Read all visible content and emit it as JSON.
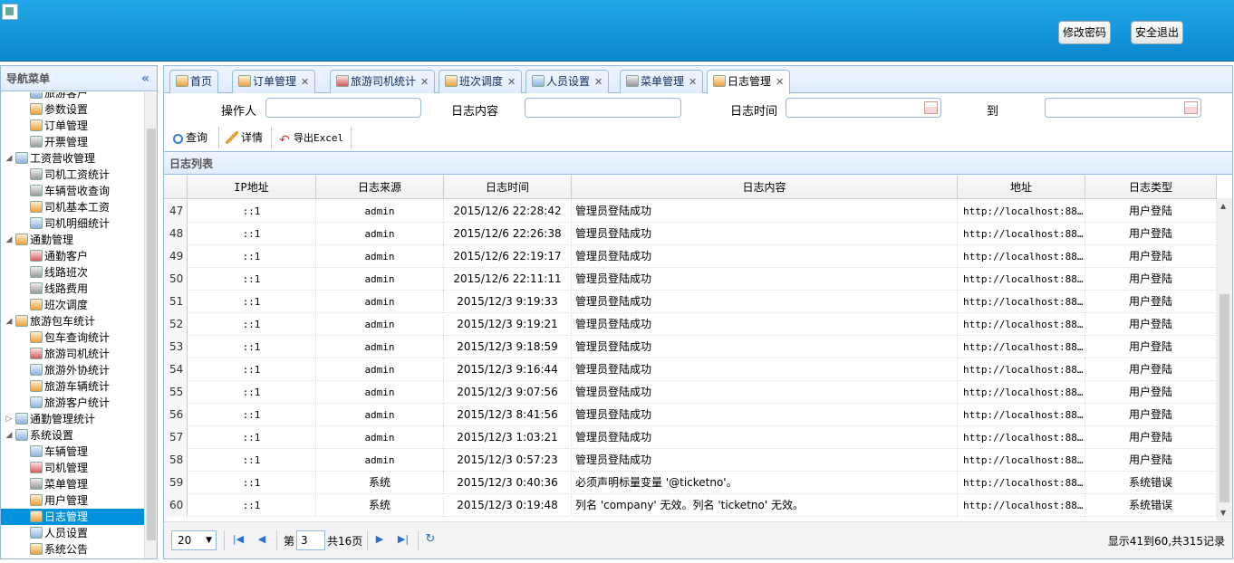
{
  "header": {
    "change_password": "修改密码",
    "logout": "安全退出"
  },
  "nav": {
    "title": "导航菜单",
    "collapse_icon": "«",
    "items": [
      {
        "label": "旅游客户",
        "level": 1,
        "icon": "b"
      },
      {
        "label": "参数设置",
        "level": 1,
        "icon": "o"
      },
      {
        "label": "订单管理",
        "level": 1,
        "icon": "o"
      },
      {
        "label": "开票管理",
        "level": 1,
        "icon": "g"
      },
      {
        "label": "工资营收管理",
        "level": 0,
        "icon": "b",
        "arrow": "◢"
      },
      {
        "label": "司机工资统计",
        "level": 1,
        "icon": "g"
      },
      {
        "label": "车辆营收查询",
        "level": 1,
        "icon": "g"
      },
      {
        "label": "司机基本工资",
        "level": 1,
        "icon": "o"
      },
      {
        "label": "司机明细统计",
        "level": 1,
        "icon": "b"
      },
      {
        "label": "通勤管理",
        "level": 0,
        "icon": "o",
        "arrow": "◢"
      },
      {
        "label": "通勤客户",
        "level": 1,
        "icon": "r"
      },
      {
        "label": "线路班次",
        "level": 1,
        "icon": "g"
      },
      {
        "label": "线路费用",
        "level": 1,
        "icon": "g"
      },
      {
        "label": "班次调度",
        "level": 1,
        "icon": "o"
      },
      {
        "label": "旅游包车统计",
        "level": 0,
        "icon": "o",
        "arrow": "◢"
      },
      {
        "label": "包车查询统计",
        "level": 1,
        "icon": "o"
      },
      {
        "label": "旅游司机统计",
        "level": 1,
        "icon": "r"
      },
      {
        "label": "旅游外协统计",
        "level": 1,
        "icon": "b"
      },
      {
        "label": "旅游车辆统计",
        "level": 1,
        "icon": "o"
      },
      {
        "label": "旅游客户统计",
        "level": 1,
        "icon": "b"
      },
      {
        "label": "通勤管理统计",
        "level": 0,
        "icon": "b",
        "arrow": "▷"
      },
      {
        "label": "系统设置",
        "level": 0,
        "icon": "b",
        "arrow": "◢"
      },
      {
        "label": "车辆管理",
        "level": 1,
        "icon": "b"
      },
      {
        "label": "司机管理",
        "level": 1,
        "icon": "r"
      },
      {
        "label": "菜单管理",
        "level": 1,
        "icon": "g"
      },
      {
        "label": "用户管理",
        "level": 1,
        "icon": "o"
      },
      {
        "label": "日志管理",
        "level": 1,
        "icon": "o",
        "selected": true
      },
      {
        "label": "人员设置",
        "level": 1,
        "icon": "b"
      },
      {
        "label": "系统公告",
        "level": 1,
        "icon": "o"
      }
    ]
  },
  "tabs": [
    {
      "label": "首页",
      "closable": false,
      "icon": "o"
    },
    {
      "label": "订单管理",
      "closable": true,
      "icon": "o"
    },
    {
      "label": "旅游司机统计",
      "closable": true,
      "icon": "r"
    },
    {
      "label": "班次调度",
      "closable": true,
      "icon": "o"
    },
    {
      "label": "人员设置",
      "closable": true,
      "icon": "b"
    },
    {
      "label": "菜单管理",
      "closable": true,
      "icon": "g"
    },
    {
      "label": "日志管理",
      "closable": true,
      "icon": "o",
      "active": true
    }
  ],
  "filter": {
    "operator_label": "操作人",
    "content_label": "日志内容",
    "time_label": "日志时间",
    "to_label": "到"
  },
  "toolbar": {
    "query": "查询",
    "detail": "详情",
    "export": "导出Excel"
  },
  "grid": {
    "title": "日志列表",
    "columns": [
      "IP地址",
      "日志来源",
      "日志时间",
      "日志内容",
      "地址",
      "日志类型"
    ],
    "rows": [
      {
        "n": "47",
        "ip": "::1",
        "src": "admin",
        "time": "2015/12/6 22:28:42",
        "content": "管理员登陆成功",
        "addr": "http://localhost:88…",
        "type": "用户登陆"
      },
      {
        "n": "48",
        "ip": "::1",
        "src": "admin",
        "time": "2015/12/6 22:26:38",
        "content": "管理员登陆成功",
        "addr": "http://localhost:88…",
        "type": "用户登陆"
      },
      {
        "n": "49",
        "ip": "::1",
        "src": "admin",
        "time": "2015/12/6 22:19:17",
        "content": "管理员登陆成功",
        "addr": "http://localhost:88…",
        "type": "用户登陆"
      },
      {
        "n": "50",
        "ip": "::1",
        "src": "admin",
        "time": "2015/12/6 22:11:11",
        "content": "管理员登陆成功",
        "addr": "http://localhost:88…",
        "type": "用户登陆"
      },
      {
        "n": "51",
        "ip": "::1",
        "src": "admin",
        "time": "2015/12/3 9:19:33",
        "content": "管理员登陆成功",
        "addr": "http://localhost:88…",
        "type": "用户登陆"
      },
      {
        "n": "52",
        "ip": "::1",
        "src": "admin",
        "time": "2015/12/3 9:19:21",
        "content": "管理员登陆成功",
        "addr": "http://localhost:88…",
        "type": "用户登陆"
      },
      {
        "n": "53",
        "ip": "::1",
        "src": "admin",
        "time": "2015/12/3 9:18:59",
        "content": "管理员登陆成功",
        "addr": "http://localhost:88…",
        "type": "用户登陆"
      },
      {
        "n": "54",
        "ip": "::1",
        "src": "admin",
        "time": "2015/12/3 9:16:44",
        "content": "管理员登陆成功",
        "addr": "http://localhost:88…",
        "type": "用户登陆"
      },
      {
        "n": "55",
        "ip": "::1",
        "src": "admin",
        "time": "2015/12/3 9:07:56",
        "content": "管理员登陆成功",
        "addr": "http://localhost:88…",
        "type": "用户登陆"
      },
      {
        "n": "56",
        "ip": "::1",
        "src": "admin",
        "time": "2015/12/3 8:41:56",
        "content": "管理员登陆成功",
        "addr": "http://localhost:88…",
        "type": "用户登陆"
      },
      {
        "n": "57",
        "ip": "::1",
        "src": "admin",
        "time": "2015/12/3 1:03:21",
        "content": "管理员登陆成功",
        "addr": "http://localhost:88…",
        "type": "用户登陆"
      },
      {
        "n": "58",
        "ip": "::1",
        "src": "admin",
        "time": "2015/12/3 0:57:23",
        "content": "管理员登陆成功",
        "addr": "http://localhost:88…",
        "type": "用户登陆"
      },
      {
        "n": "59",
        "ip": "::1",
        "src": "系统",
        "time": "2015/12/3 0:40:36",
        "content": "必须声明标量变量 '@ticketno'。",
        "addr": "http://localhost:88…",
        "type": "系统错误"
      },
      {
        "n": "60",
        "ip": "::1",
        "src": "系统",
        "time": "2015/12/3 0:19:48",
        "content": "列名 'company' 无效。列名 'ticketno' 无效。",
        "addr": "http://localhost:88…",
        "type": "系统错误"
      }
    ]
  },
  "pager": {
    "page_size": "20",
    "page_prefix": "第",
    "page": "3",
    "page_total": "共16页",
    "summary": "显示41到60,共315记录"
  }
}
